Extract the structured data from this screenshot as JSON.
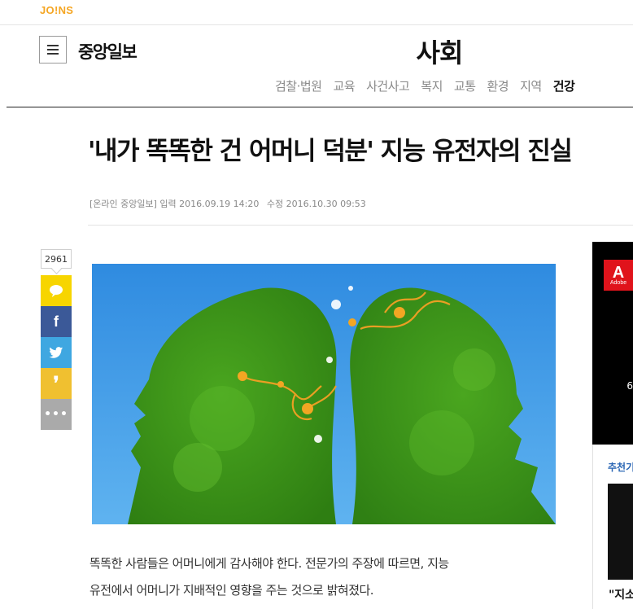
{
  "top": {
    "brand_network": "JO!NS"
  },
  "header": {
    "brand": "중앙일보",
    "section": "사회",
    "subnav": [
      {
        "label": "검찰·법원",
        "active": false
      },
      {
        "label": "교육",
        "active": false
      },
      {
        "label": "사건사고",
        "active": false
      },
      {
        "label": "복지",
        "active": false
      },
      {
        "label": "교통",
        "active": false
      },
      {
        "label": "환경",
        "active": false
      },
      {
        "label": "지역",
        "active": false
      },
      {
        "label": "건강",
        "active": true
      }
    ]
  },
  "article": {
    "headline": "'내가 똑똑한 건 어머니 덕분' 지능 유전자의 진실",
    "source": "[온라인 중앙일보]",
    "input_label": "입력",
    "input_time": "2016.09.19 14:20",
    "modified_label": "수정",
    "modified_time": "2016.10.30 09:53",
    "body": [
      "똑똑한 사람들은 어머니에게 감사해야 한다. 전문가의 주장에 따르면, 지능",
      "유전에서 어머니가 지배적인 영향을 주는 것으로 밝혀졌다."
    ]
  },
  "share": {
    "count": "2961",
    "buttons": [
      {
        "name": "kakao-story",
        "glyph": "💬"
      },
      {
        "name": "facebook",
        "glyph": "f"
      },
      {
        "name": "twitter",
        "glyph": "🐦"
      },
      {
        "name": "quote",
        "glyph": "❜"
      },
      {
        "name": "more",
        "glyph": "•••"
      }
    ]
  },
  "aside": {
    "ad_brand": "Adobe",
    "ad_brand_mark": "A",
    "ad_partial_number": "6",
    "recommend_label": "추천기",
    "headline_partial": "\"지소"
  },
  "colors": {
    "accent_joins": "#f5a623",
    "facebook": "#3b5998",
    "twitter": "#3fa7e1",
    "kakao": "#f7d500",
    "adobe": "#e0131b",
    "link_blue": "#2a66b4"
  }
}
